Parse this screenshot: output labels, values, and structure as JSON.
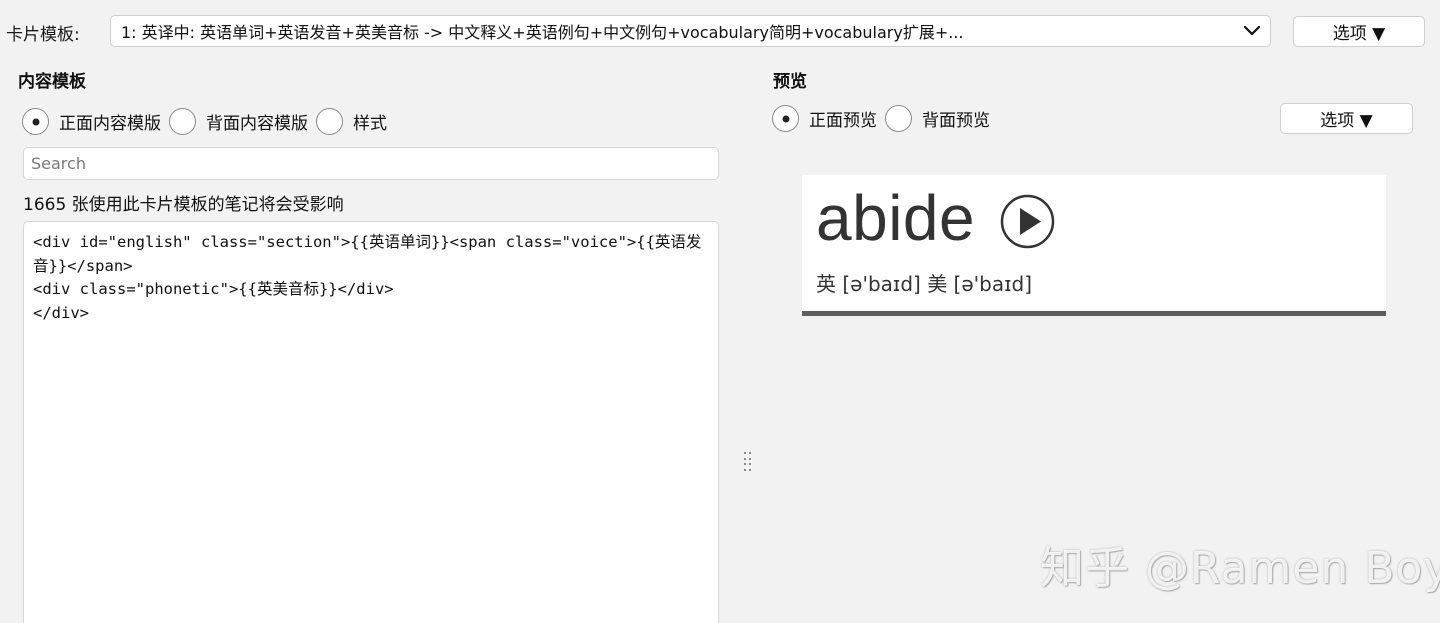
{
  "topbar": {
    "label": "卡片模板:",
    "template_selected": "1: 英译中: 英语单词+英语发音+英美音标 -> 中文释义+英语例句+中文例句+vocabulary简明+vocabulary扩展+...",
    "options_label": "选项 ▼"
  },
  "content": {
    "heading": "内容模板",
    "radios": [
      {
        "label": "正面内容模版",
        "checked": true
      },
      {
        "label": "背面内容模版",
        "checked": false
      },
      {
        "label": "样式",
        "checked": false
      }
    ],
    "search_placeholder": "Search",
    "affected_text": "1665 张使用此卡片模板的笔记将会受影响",
    "code_lines": [
      "<div id=\"english\" class=\"section\">{{英语单词}}<span class=\"voice\">{{英语发音}}</span>",
      "<div class=\"phonetic\">{{英美音标}}</div>",
      "</div>"
    ]
  },
  "preview": {
    "heading": "预览",
    "radios": [
      {
        "label": "正面预览",
        "checked": true
      },
      {
        "label": "背面预览",
        "checked": false
      }
    ],
    "options_label": "选项 ▼",
    "card": {
      "word": "abide",
      "phonetic": "英 [ə'baɪd] 美 [ə'baɪd]",
      "play_icon": "play-circle-icon"
    }
  },
  "watermark": "知乎 @Ramen Boy",
  "colors": {
    "background": "#f2f2f2",
    "card_text": "#333333",
    "card_bottom_bar": "#5e5e5e"
  }
}
